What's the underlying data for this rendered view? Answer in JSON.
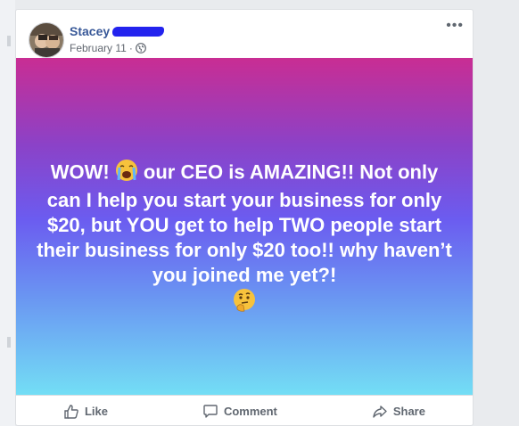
{
  "post": {
    "author_name": "Stacey",
    "date": "February 11",
    "separator": "·",
    "visibility_icon": "globe-icon",
    "more_icon": "more-options-icon",
    "more_label": "•••",
    "text_segments": [
      "WOW! ",
      " our CEO is AMAZING!! Not only can I help you start your business for only $20, but YOU get to help TWO people start their business for only $20 too!! why haven’t you joined me yet?! "
    ],
    "emojis": [
      "crying-face-emoji",
      "thinking-face-emoji"
    ],
    "background_colors": [
      "#c92d93",
      "#8b42c8",
      "#6b5cf0",
      "#6a93f2",
      "#73def5"
    ]
  },
  "actions": {
    "like": "Like",
    "comment": "Comment",
    "share": "Share"
  },
  "colors": {
    "author": "#385898",
    "meta": "#616770",
    "redaction": "#2323ee",
    "action_text": "#606770"
  }
}
